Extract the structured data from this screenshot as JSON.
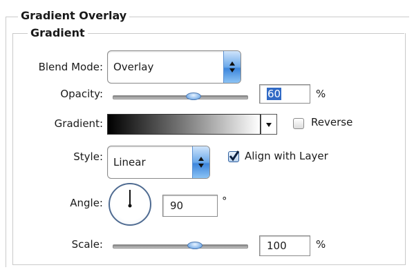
{
  "panel": {
    "title": "Gradient Overlay",
    "group_title": "Gradient"
  },
  "blend_mode": {
    "label": "Blend Mode:",
    "value": "Overlay"
  },
  "opacity": {
    "label": "Opacity:",
    "value": "60",
    "unit": "%",
    "slider_fraction": 0.6
  },
  "gradient": {
    "label": "Gradient:",
    "stops": [
      "#000000",
      "#ffffff"
    ]
  },
  "reverse": {
    "label": "Reverse",
    "checked": false
  },
  "style": {
    "label": "Style:",
    "value": "Linear"
  },
  "align_with_layer": {
    "label": "Align with Layer",
    "checked": true
  },
  "angle": {
    "label": "Angle:",
    "value": "90",
    "unit": "°"
  },
  "scale": {
    "label": "Scale:",
    "value": "100",
    "unit": "%",
    "slider_fraction": 0.61
  },
  "colors": {
    "accent": "#4d8ad8",
    "highlight": "#316ac5"
  }
}
